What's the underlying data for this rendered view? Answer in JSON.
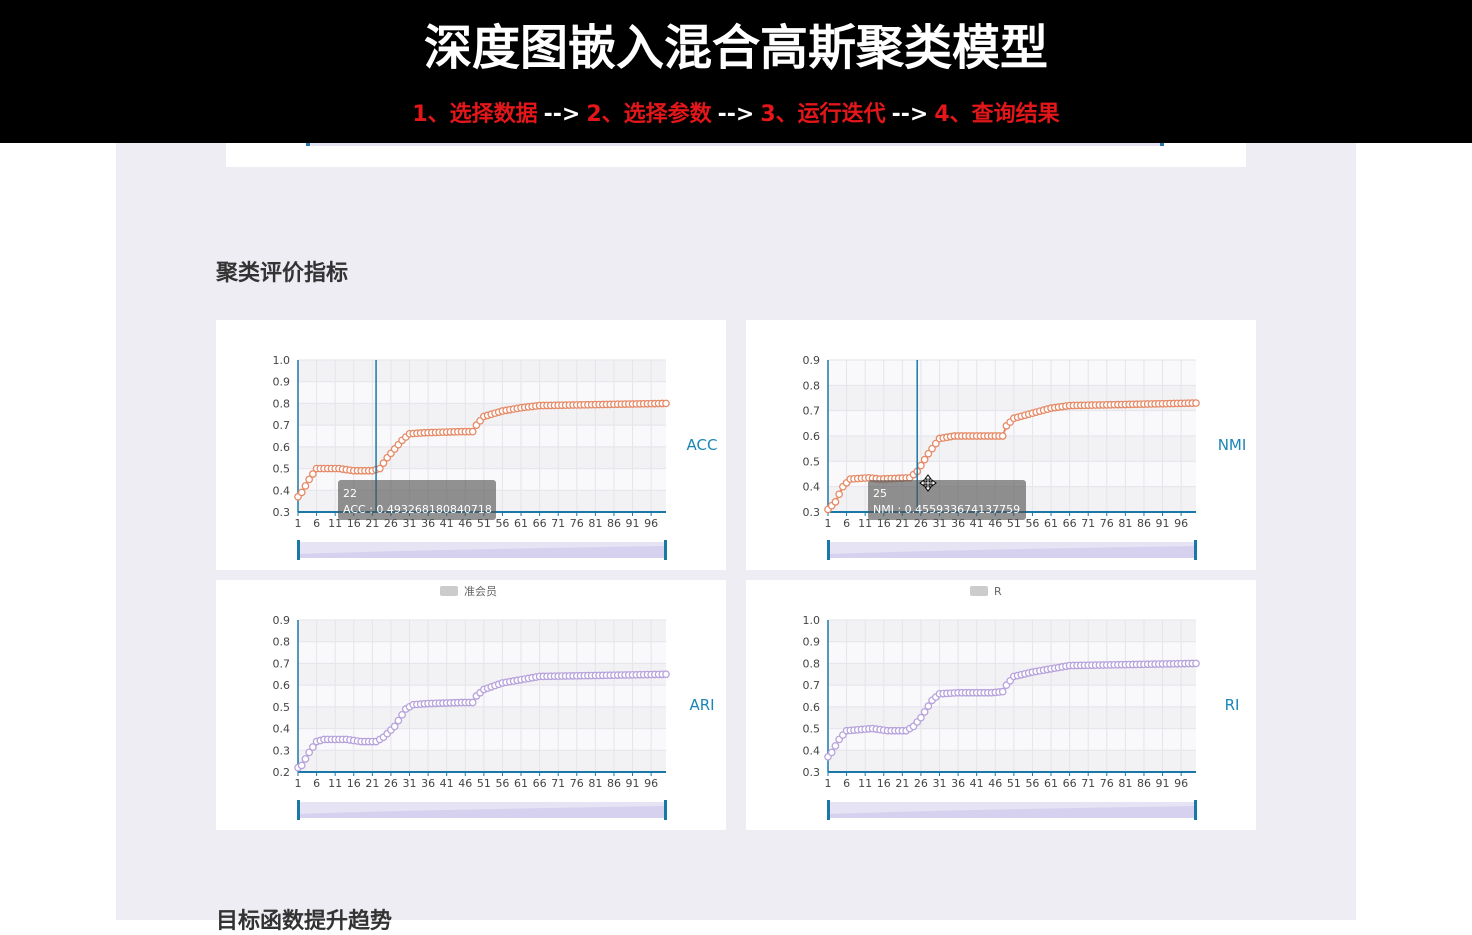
{
  "banner": {
    "title": "深度图嵌入混合高斯聚类模型",
    "steps": [
      "1、选择数据",
      "2、选择参数",
      "3、运行迭代",
      "4、查询结果"
    ],
    "arrow": "-->"
  },
  "section_metrics_title": "聚类评价指标",
  "section_objective_title": "目标函数提升趋势",
  "colors": {
    "orange": "#e68a67",
    "purple": "#b7a3dc",
    "axis": "#1a78a6",
    "label": "#1a86b6"
  },
  "chart_data": [
    {
      "type": "line",
      "metric": "ACC",
      "color": "#e68a67",
      "ylim": [
        0.3,
        1.0
      ],
      "yticks": [
        0.3,
        0.4,
        0.5,
        0.6,
        0.7,
        0.8,
        0.9,
        1.0
      ],
      "xticks": [
        1,
        6,
        11,
        16,
        21,
        26,
        31,
        36,
        41,
        46,
        51,
        56,
        61,
        66,
        71,
        76,
        81,
        86,
        91,
        96
      ],
      "x_count": 100,
      "keypoints": [
        [
          1,
          0.37
        ],
        [
          2,
          0.39
        ],
        [
          4,
          0.45
        ],
        [
          6,
          0.5
        ],
        [
          12,
          0.5
        ],
        [
          16,
          0.49
        ],
        [
          21,
          0.49
        ],
        [
          23,
          0.5
        ],
        [
          25,
          0.55
        ],
        [
          29,
          0.63
        ],
        [
          31,
          0.66
        ],
        [
          35,
          0.665
        ],
        [
          45,
          0.67
        ],
        [
          48,
          0.67
        ],
        [
          49,
          0.7
        ],
        [
          51,
          0.74
        ],
        [
          56,
          0.765
        ],
        [
          61,
          0.78
        ],
        [
          66,
          0.79
        ],
        [
          100,
          0.8
        ]
      ],
      "tooltip": {
        "title": "22",
        "value": "ACC : 0.493268180840718",
        "x": 22
      },
      "legend": ""
    },
    {
      "type": "line",
      "metric": "NMI",
      "color": "#e68a67",
      "ylim": [
        0.3,
        0.9
      ],
      "yticks": [
        0.3,
        0.4,
        0.5,
        0.6,
        0.7,
        0.8,
        0.9
      ],
      "xticks": [
        1,
        6,
        11,
        16,
        21,
        26,
        31,
        36,
        41,
        46,
        51,
        56,
        61,
        66,
        71,
        76,
        81,
        86,
        91,
        96
      ],
      "x_count": 100,
      "keypoints": [
        [
          1,
          0.31
        ],
        [
          3,
          0.34
        ],
        [
          5,
          0.4
        ],
        [
          7,
          0.43
        ],
        [
          12,
          0.435
        ],
        [
          15,
          0.43
        ],
        [
          23,
          0.435
        ],
        [
          25,
          0.46
        ],
        [
          28,
          0.53
        ],
        [
          31,
          0.59
        ],
        [
          35,
          0.6
        ],
        [
          45,
          0.6
        ],
        [
          48,
          0.6
        ],
        [
          49,
          0.64
        ],
        [
          51,
          0.67
        ],
        [
          56,
          0.69
        ],
        [
          61,
          0.71
        ],
        [
          66,
          0.72
        ],
        [
          100,
          0.73
        ]
      ],
      "tooltip": {
        "title": "25",
        "value": "NMI : 0.455933674137759",
        "x": 25
      },
      "legend": ""
    },
    {
      "type": "line",
      "metric": "ARI",
      "color": "#b7a3dc",
      "ylim": [
        0.2,
        0.9
      ],
      "yticks": [
        0.2,
        0.3,
        0.4,
        0.5,
        0.6,
        0.7,
        0.8,
        0.9
      ],
      "xticks": [
        1,
        6,
        11,
        16,
        21,
        26,
        31,
        36,
        41,
        46,
        51,
        56,
        61,
        66,
        71,
        76,
        81,
        86,
        91,
        96
      ],
      "x_count": 100,
      "keypoints": [
        [
          1,
          0.22
        ],
        [
          2,
          0.23
        ],
        [
          4,
          0.29
        ],
        [
          6,
          0.34
        ],
        [
          8,
          0.35
        ],
        [
          14,
          0.35
        ],
        [
          18,
          0.34
        ],
        [
          22,
          0.34
        ],
        [
          24,
          0.36
        ],
        [
          27,
          0.41
        ],
        [
          30,
          0.49
        ],
        [
          32,
          0.51
        ],
        [
          36,
          0.515
        ],
        [
          45,
          0.52
        ],
        [
          48,
          0.52
        ],
        [
          49,
          0.55
        ],
        [
          51,
          0.58
        ],
        [
          56,
          0.61
        ],
        [
          61,
          0.625
        ],
        [
          66,
          0.64
        ],
        [
          100,
          0.65
        ]
      ],
      "legend": "准会员"
    },
    {
      "type": "line",
      "metric": "RI",
      "color": "#b7a3dc",
      "ylim": [
        0.3,
        1.0
      ],
      "yticks": [
        0.3,
        0.4,
        0.5,
        0.6,
        0.7,
        0.8,
        0.9,
        1.0
      ],
      "xticks": [
        1,
        6,
        11,
        16,
        21,
        26,
        31,
        36,
        41,
        46,
        51,
        56,
        61,
        66,
        71,
        76,
        81,
        86,
        91,
        96
      ],
      "x_count": 100,
      "keypoints": [
        [
          1,
          0.37
        ],
        [
          2,
          0.39
        ],
        [
          4,
          0.45
        ],
        [
          6,
          0.49
        ],
        [
          13,
          0.5
        ],
        [
          17,
          0.49
        ],
        [
          22,
          0.49
        ],
        [
          24,
          0.51
        ],
        [
          26,
          0.55
        ],
        [
          29,
          0.63
        ],
        [
          31,
          0.66
        ],
        [
          36,
          0.665
        ],
        [
          45,
          0.665
        ],
        [
          48,
          0.67
        ],
        [
          49,
          0.7
        ],
        [
          51,
          0.74
        ],
        [
          56,
          0.76
        ],
        [
          61,
          0.775
        ],
        [
          66,
          0.79
        ],
        [
          100,
          0.8
        ]
      ],
      "legend": "R"
    }
  ]
}
